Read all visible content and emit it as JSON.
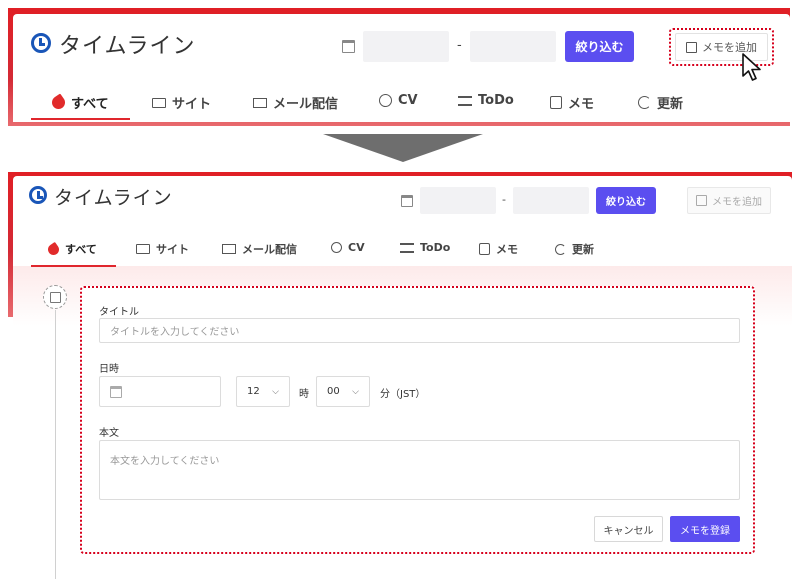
{
  "top": {
    "title": "タイムライン",
    "date_separator": "-",
    "filter_button": "絞り込む",
    "add_memo_button": "メモを追加",
    "tabs": [
      {
        "label": "すべて",
        "icon": "rocket-icon",
        "active": true
      },
      {
        "label": "サイト",
        "icon": "monitor-icon"
      },
      {
        "label": "メール配信",
        "icon": "mail-icon"
      },
      {
        "label": "CV",
        "icon": "chat-bubble-icon"
      },
      {
        "label": "ToDo",
        "icon": "list-icon"
      },
      {
        "label": "メモ",
        "icon": "clipboard-icon"
      },
      {
        "label": "更新",
        "icon": "refresh-icon"
      }
    ]
  },
  "bottom": {
    "title": "タイムライン",
    "date_separator": "-",
    "filter_button": "絞り込む",
    "add_memo_button": "メモを追加",
    "tabs": [
      {
        "label": "すべて",
        "icon": "rocket-icon",
        "active": true
      },
      {
        "label": "サイト",
        "icon": "monitor-icon"
      },
      {
        "label": "メール配信",
        "icon": "mail-icon"
      },
      {
        "label": "CV",
        "icon": "chat-bubble-icon"
      },
      {
        "label": "ToDo",
        "icon": "list-icon"
      },
      {
        "label": "メモ",
        "icon": "clipboard-icon"
      },
      {
        "label": "更新",
        "icon": "refresh-icon"
      }
    ],
    "form": {
      "title_label": "タイトル",
      "title_placeholder": "タイトルを入力してください",
      "datetime_label": "日時",
      "hour_value": "12",
      "hour_unit": "時",
      "minute_value": "00",
      "minute_unit": "分（JST）",
      "body_label": "本文",
      "body_placeholder": "本文を入力してください",
      "cancel_button": "キャンセル",
      "submit_button": "メモを登録"
    }
  },
  "colors": {
    "accent": "#5b4ef0",
    "brand_red": "#e0262d",
    "highlight": "#d6001c",
    "clock_blue": "#1a56b8"
  }
}
